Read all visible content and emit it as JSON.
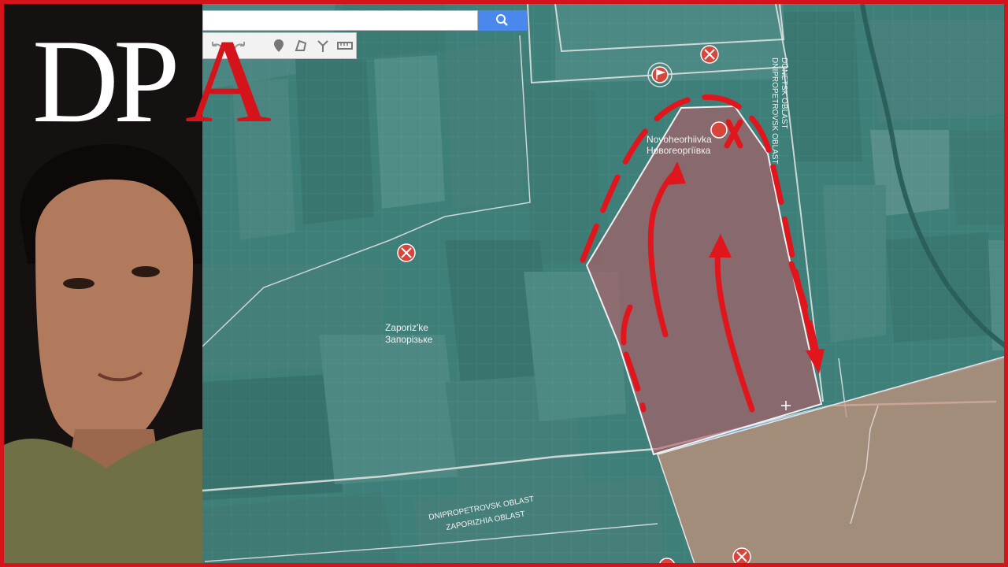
{
  "logo": {
    "text_d": "D",
    "text_p": "P",
    "text_a": "A"
  },
  "map": {
    "labels": {
      "novoheorhiivka_latin": "Novoheorhiivka",
      "novoheorhiivka_cyrillic": "Новогеоргіївка",
      "zaporizke_latin": "Zaporiz'ke",
      "zaporizke_cyrillic": "Запорізьке",
      "donetsk_oblast": "DONETSK OBLAST",
      "dnipropetrovsk_oblast_vertical": "DNIPROPETROVSK OBLAST",
      "dnipropetrovsk_oblast_border": "DNIPROPETROVSK OBLAST",
      "zaporizhia_oblast_border": "ZAPORIZHIA OBLAST"
    },
    "colors": {
      "frame_red": "#d4141a",
      "marker_red": "#d7463c",
      "annotation_red": "#e0161c",
      "contested_zone": "#b85a66",
      "occupied_zone": "#c9927a",
      "map_tint": "#3f7f7a",
      "boundary_line": "#e6e6e6"
    }
  },
  "toolbar": {
    "search_placeholder": "",
    "tools": [
      "undo-icon",
      "redo-icon",
      "marker-icon",
      "polygon-icon",
      "route-icon",
      "ruler-icon"
    ]
  }
}
